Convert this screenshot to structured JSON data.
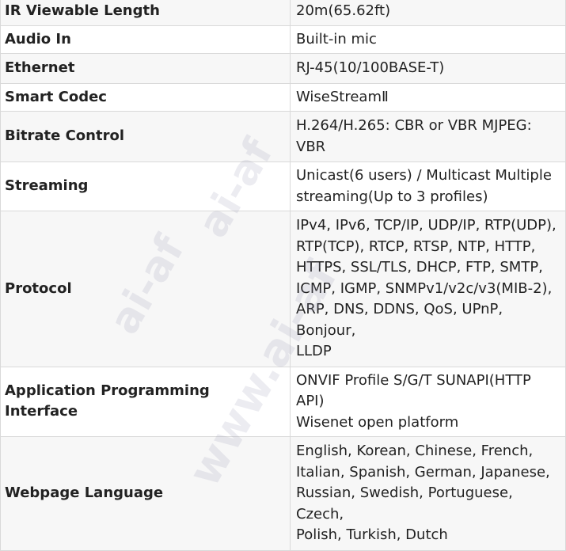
{
  "specs": [
    {
      "label": "IR Viewable Length",
      "value": [
        "20m(65.62ft)"
      ]
    },
    {
      "label": "Audio In",
      "value": [
        "Built-in mic"
      ]
    },
    {
      "label": "Ethernet",
      "value": [
        "RJ-45(10/100BASE-T)"
      ]
    },
    {
      "label": "Smart Codec",
      "value": [
        "WiseStreamⅡ"
      ]
    },
    {
      "label": "Bitrate Control",
      "value": [
        "H.264/H.265: CBR or VBR MJPEG: VBR"
      ]
    },
    {
      "label": "Streaming",
      "value": [
        "Unicast(6 users) / Multicast Multiple",
        "streaming(Up to 3 profiles)"
      ]
    },
    {
      "label": "Protocol",
      "value": [
        "IPv4, IPv6, TCP/IP, UDP/IP, RTP(UDP),",
        "RTP(TCP), RTCP, RTSP, NTP, HTTP,",
        "HTTPS, SSL/TLS, DHCP, FTP, SMTP,",
        "ICMP, IGMP, SNMPv1/v2c/v3(MIB-2),",
        "ARP, DNS, DDNS, QoS, UPnP, Bonjour,",
        "LLDP"
      ]
    },
    {
      "label": "Application Programming Interface",
      "value": [
        "ONVIF Profile S/G/T SUNAPI(HTTP API)",
        "Wisenet open platform"
      ]
    },
    {
      "label": "Webpage Language",
      "value": [
        "English, Korean, Chinese, French,",
        "Italian, Spanish, German, Japanese,",
        "Russian, Swedish, Portuguese, Czech,",
        "Polish, Turkish, Dutch"
      ]
    }
  ],
  "watermark": {
    "top": "ai-af",
    "bottom": "www.ai-af"
  }
}
